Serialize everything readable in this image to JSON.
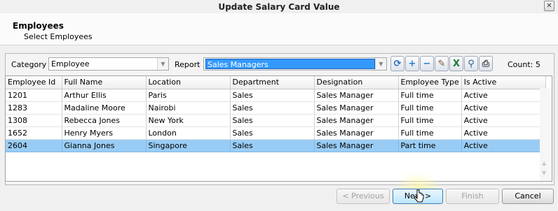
{
  "window": {
    "title": "Update Salary Card Value",
    "close_glyph": "✕"
  },
  "header": {
    "title": "Employees",
    "subtitle": "Select Employees"
  },
  "filters": {
    "category_label": "Category",
    "category_value": "Employee",
    "report_label": "Report",
    "report_value": "Sales Managers",
    "count_text": "Count: 5"
  },
  "toolbar": {
    "icons": [
      "refresh-icon",
      "add-icon",
      "remove-icon",
      "edit-icon",
      "excel-icon",
      "search-icon",
      "print-icon"
    ],
    "glyphs": [
      "⟳",
      "+",
      "−",
      "✎",
      "X",
      "⚲",
      "⎙"
    ]
  },
  "grid": {
    "columns": [
      "Employee Id",
      "Full Name",
      "Location",
      "Department",
      "Designation",
      "Employee Type",
      "Is Active"
    ],
    "rows": [
      [
        "1201",
        "Arthur Ellis",
        "Paris",
        "Sales",
        "Sales Manager",
        "Full time",
        "Active"
      ],
      [
        "1283",
        "Madaline Moore",
        "Nairobi",
        "Sales",
        "Sales Manager",
        "Full time",
        "Active"
      ],
      [
        "1308",
        "Rebecca Jones",
        "New York",
        "Sales",
        "Sales Manager",
        "Full time",
        "Active"
      ],
      [
        "1652",
        "Henry Myers",
        "London",
        "Sales",
        "Sales Manager",
        "Full time",
        "Active"
      ],
      [
        "2604",
        "Gianna Jones",
        "Singapore",
        "Sales",
        "Sales Manager",
        "Part time",
        "Active"
      ]
    ],
    "selected_row": 4
  },
  "buttons": {
    "previous": "< Previous",
    "next": "Next >",
    "finish": "Finish",
    "cancel": "Cancel"
  },
  "colors": {
    "selection": "#99ccf5",
    "report_highlight": "#3399ff"
  }
}
